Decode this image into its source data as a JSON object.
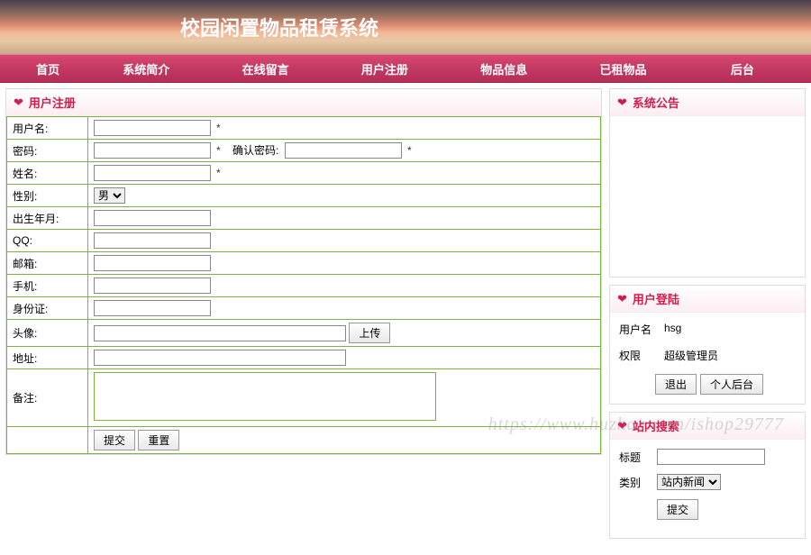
{
  "banner": {
    "title": "校园闲置物品租赁系统"
  },
  "nav": {
    "items": [
      {
        "label": "首页"
      },
      {
        "label": "系统简介"
      },
      {
        "label": "在线留言"
      },
      {
        "label": "用户注册"
      },
      {
        "label": "物品信息"
      },
      {
        "label": "已租物品"
      },
      {
        "label": "后台"
      }
    ]
  },
  "register": {
    "title": "用户注册",
    "labels": {
      "username": "用户名:",
      "password": "密码:",
      "confirm": "确认密码:",
      "name": "姓名:",
      "gender": "性别:",
      "birth": "出生年月:",
      "qq": "QQ:",
      "email": "邮箱:",
      "phone": "手机:",
      "idcard": "身份证:",
      "avatar": "头像:",
      "address": "地址:",
      "remark": "备注:"
    },
    "gender_option": "男",
    "upload_label": "上传",
    "submit_label": "提交",
    "reset_label": "重置",
    "required_mark": "*"
  },
  "announce": {
    "title": "系统公告"
  },
  "login": {
    "title": "用户登陆",
    "username_label": "用户名",
    "username_value": "hsg",
    "role_label": "权限",
    "role_value": "超级管理员",
    "logout_label": "退出",
    "profile_label": "个人后台"
  },
  "search": {
    "title": "站内搜索",
    "title_label": "标题",
    "category_label": "类别",
    "category_option": "站内新闻",
    "submit_label": "提交"
  },
  "watermark": "https://www.huzhan.com/ishop29777"
}
